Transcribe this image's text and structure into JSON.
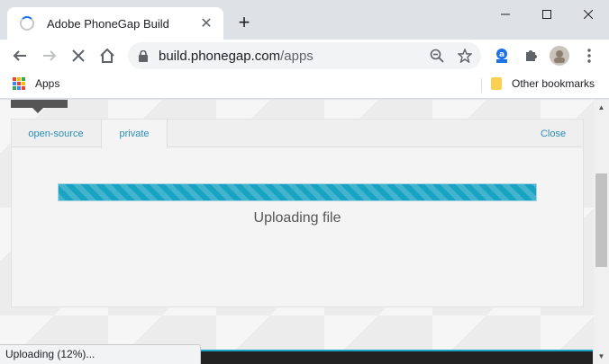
{
  "browser": {
    "tab_title": "Adobe PhoneGap Build",
    "new_tab_symbol": "+",
    "url_host": "build.phonegap.com",
    "url_path": "/apps",
    "bookmarks": {
      "apps_label": "Apps",
      "other_label": "Other bookmarks"
    }
  },
  "page": {
    "tabs": [
      {
        "label": "open-source"
      },
      {
        "label": "private"
      }
    ],
    "close_label": "Close",
    "upload": {
      "progress_fraction": 1.0,
      "message": "Uploading file"
    }
  },
  "status_bar": {
    "text": "Uploading (12%)..."
  },
  "colors": {
    "accent": "#18a3c3",
    "link": "#2a8db5"
  }
}
